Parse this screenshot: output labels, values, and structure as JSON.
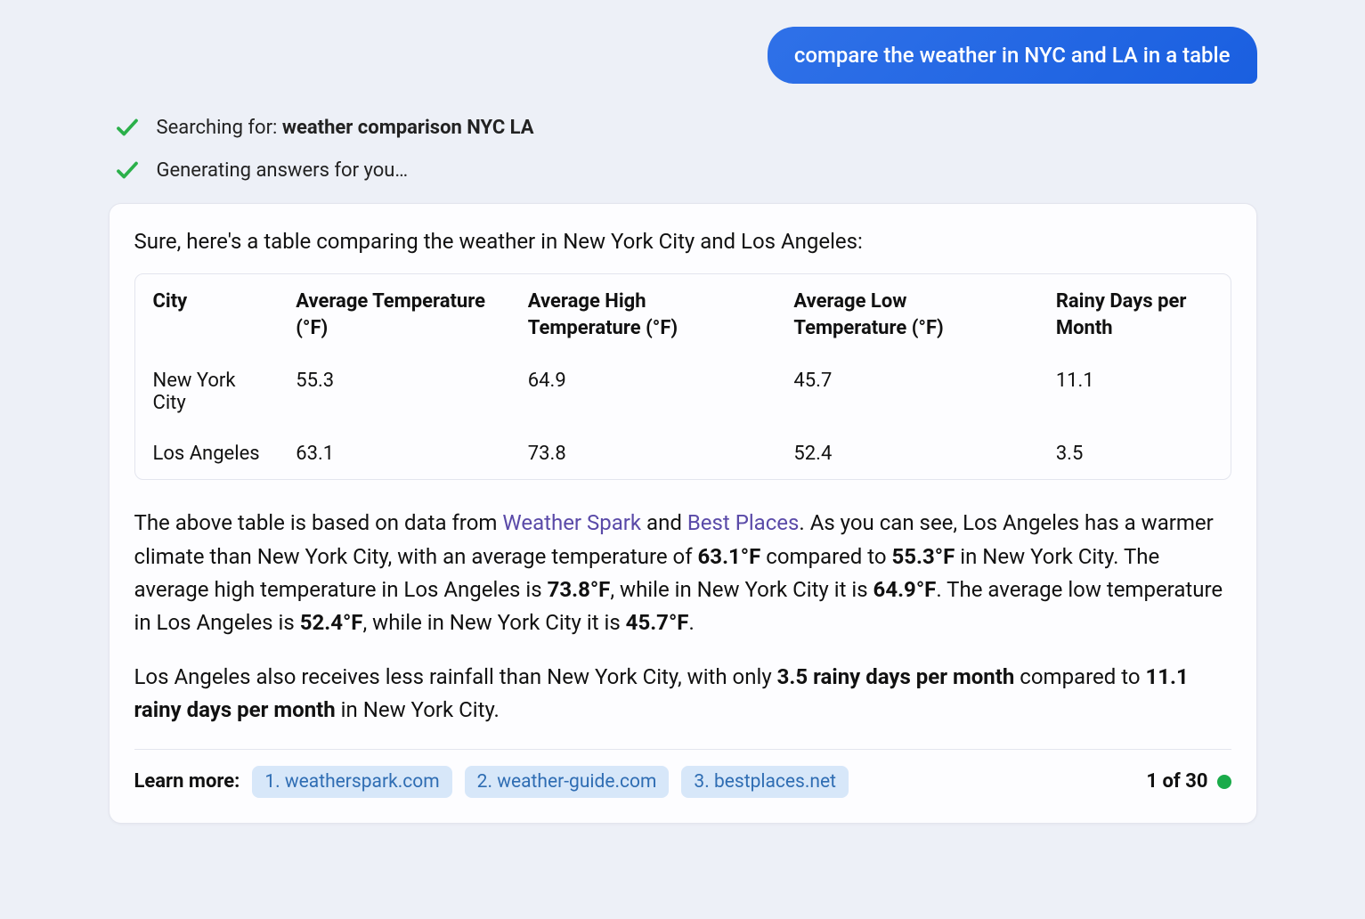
{
  "user_message": "compare the weather in NYC and LA in a table",
  "status": {
    "searching_prefix": "Searching for: ",
    "searching_query": "weather comparison NYC LA",
    "generating": "Generating answers for you…"
  },
  "answer": {
    "intro": "Sure, here's a table comparing the weather in New York City and Los Angeles:",
    "table": {
      "headers": [
        "City",
        "Average Temperature (°F)",
        "Average High Temperature (°F)",
        "Average Low Temperature (°F)",
        "Rainy Days per Month"
      ],
      "rows": [
        {
          "cells": [
            "New York City",
            "55.3",
            "64.9",
            "45.7",
            "11.1"
          ]
        },
        {
          "cells": [
            "Los Angeles",
            "63.1",
            "73.8",
            "52.4",
            "3.5"
          ]
        }
      ]
    },
    "para1": {
      "t0": "The above table is based on data from ",
      "link1": "Weather Spark",
      "t1": " and ",
      "link2": "Best Places",
      "t2": ". As you can see, Los Angeles has a warmer climate than New York City, with an average temperature of ",
      "b1": "63.1°F",
      "t3": " compared to ",
      "b2": "55.3°F",
      "t4": " in New York City. The average high temperature in Los Angeles is ",
      "b3": "73.8°F",
      "t5": ", while in New York City it is ",
      "b4": "64.9°F",
      "t6": ". The average low temperature in Los Angeles is ",
      "b5": "52.4°F",
      "t7": ", while in New York City it is ",
      "b6": "45.7°F",
      "t8": "."
    },
    "para2": {
      "t0": "Los Angeles also receives less rainfall than New York City, with only ",
      "b1": "3.5 rainy days per month",
      "t1": " compared to ",
      "b2": "11.1 rainy days per month",
      "t2": " in New York City."
    },
    "learn_more_label": "Learn more:",
    "sources": [
      "1. weatherspark.com",
      "2. weather-guide.com",
      "3. bestplaces.net"
    ],
    "counter": "1 of 30"
  },
  "chart_data": {
    "type": "table",
    "title": "Weather comparison: New York City vs Los Angeles",
    "columns": [
      "City",
      "Average Temperature (°F)",
      "Average High Temperature (°F)",
      "Average Low Temperature (°F)",
      "Rainy Days per Month"
    ],
    "rows": [
      [
        "New York City",
        55.3,
        64.9,
        45.7,
        11.1
      ],
      [
        "Los Angeles",
        63.1,
        73.8,
        52.4,
        3.5
      ]
    ]
  }
}
